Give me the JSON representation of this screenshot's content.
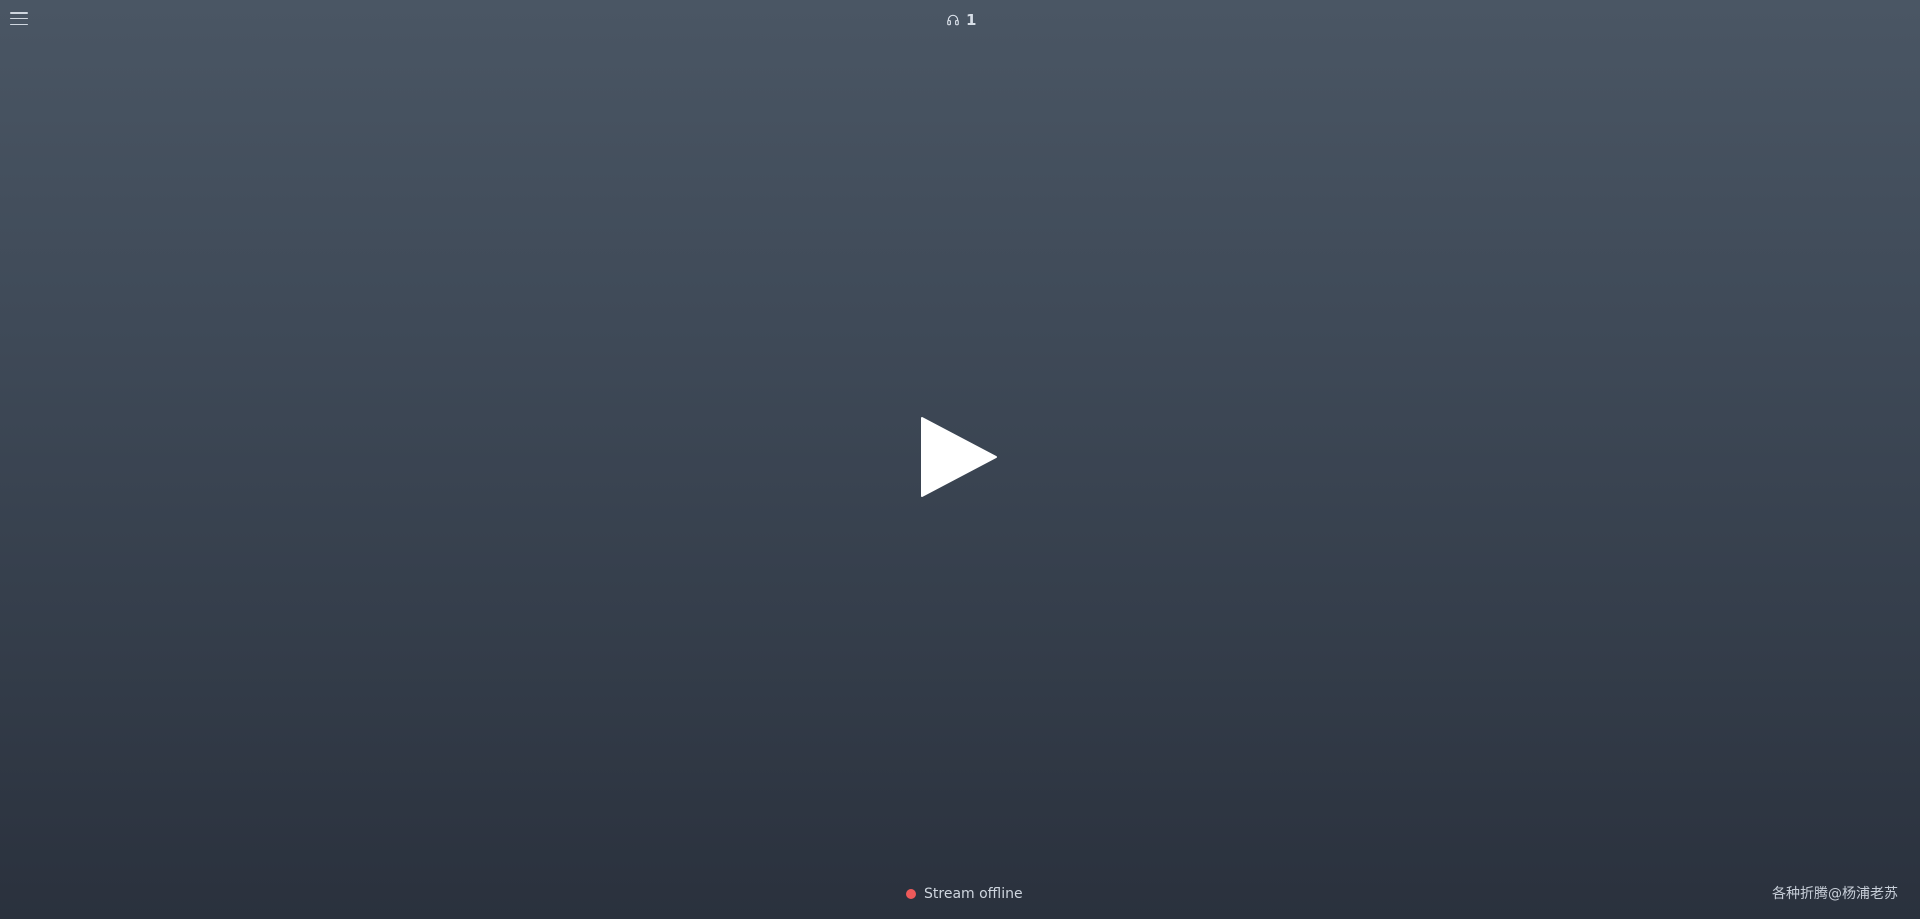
{
  "header": {
    "menu_icon": "hamburger-menu-icon",
    "listener_icon": "headphones-icon",
    "listener_count": "1"
  },
  "player": {
    "play_icon": "play-icon"
  },
  "status": {
    "text": "Stream offline",
    "dot_color": "#ee5a5a"
  },
  "footer": {
    "credit": "各种折腾@杨浦老苏"
  }
}
